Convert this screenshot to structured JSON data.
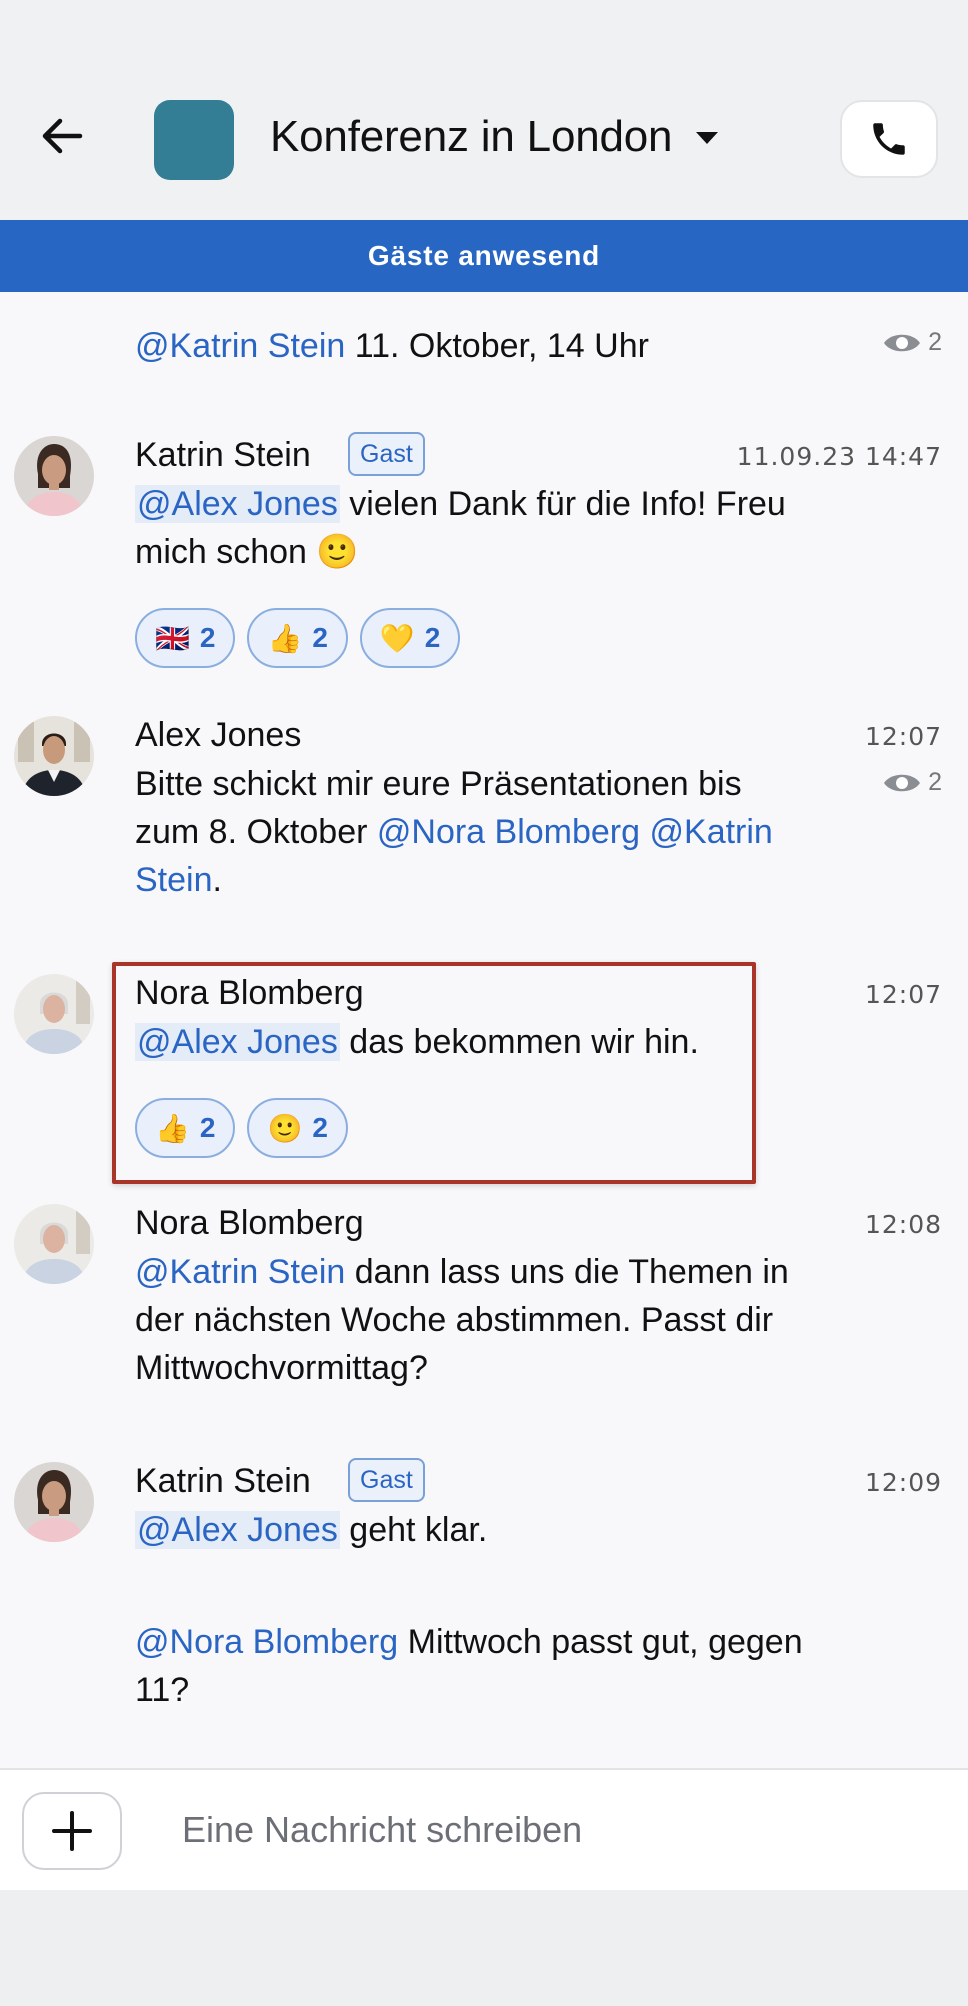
{
  "colors": {
    "accent": "#2866c4",
    "group_avatar": "#337e95",
    "highlight_border": "#a8342a"
  },
  "header": {
    "back_icon": "arrow-left-icon",
    "title": "Konferenz in London",
    "call_icon": "phone-icon"
  },
  "banner": {
    "text": "Gäste anwesend"
  },
  "messages": [
    {
      "parts": [
        {
          "mention": "@Katrin Stein"
        },
        {
          "text": " 11. Oktober, 14 Uhr"
        }
      ],
      "seen_count": "2"
    },
    {
      "sender": "Katrin Stein",
      "badge": "Gast",
      "time": "11.09.23 14:47",
      "mention": "@Alex Jones",
      "text_a": " vielen Dank für die Info! Freu",
      "text_b": "mich schon 🙂",
      "reactions": [
        {
          "emoji": "🇬🇧",
          "count": "2"
        },
        {
          "emoji": "👍",
          "count": "2"
        },
        {
          "emoji": "💛",
          "count": "2"
        }
      ]
    },
    {
      "sender": "Alex Jones",
      "time": "12:07",
      "seen_count": "2",
      "line1": "Bitte schickt mir eure Präsentationen bis",
      "line2_text": "zum 8. Oktober ",
      "mention_a": "@Nora Blomberg",
      "mention_b": "@Katrin",
      "line3_mention": "Stein",
      "line3_text": "."
    },
    {
      "sender": "Nora Blomberg",
      "time": "12:07",
      "mention": "@Alex Jones",
      "text": " das bekommen wir hin.",
      "reactions": [
        {
          "emoji": "👍",
          "count": "2"
        },
        {
          "emoji": "🙂",
          "count": "2"
        }
      ]
    },
    {
      "sender": "Nora Blomberg",
      "time": "12:08",
      "mention": "@Katrin Stein",
      "text_a": " dann lass uns die Themen in",
      "text_b": "der nächsten Woche abstimmen. Passt dir",
      "text_c": "Mittwochvormittag?"
    },
    {
      "sender": "Katrin Stein",
      "badge": "Gast",
      "time": "12:09",
      "mention": "@Alex Jones",
      "text": " geht klar."
    },
    {
      "mention": "@Nora Blomberg",
      "text_a": " Mittwoch passt gut, gegen",
      "text_b": "11?"
    }
  ],
  "composer": {
    "placeholder": "Eine Nachricht schreiben",
    "add_icon": "plus-icon"
  }
}
